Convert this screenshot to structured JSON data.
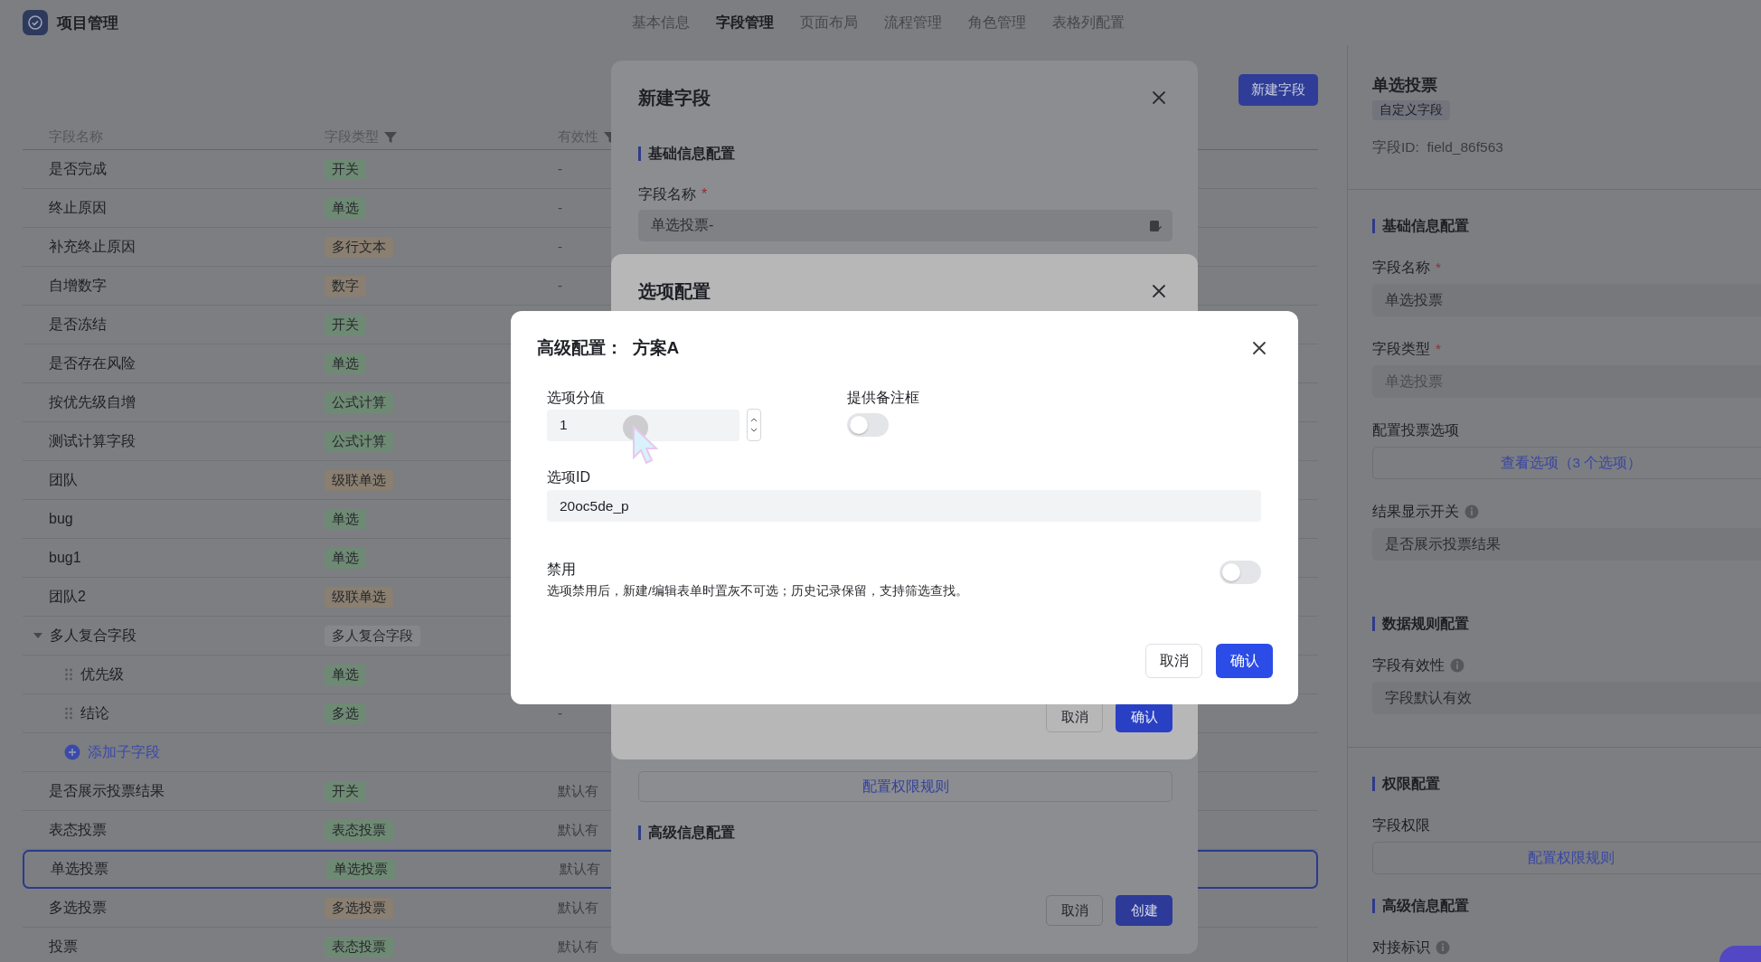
{
  "app": {
    "title": "项目管理"
  },
  "nav_tabs": [
    {
      "label": "基本信息",
      "selected": false
    },
    {
      "label": "字段管理",
      "selected": true
    },
    {
      "label": "页面布局",
      "selected": false
    },
    {
      "label": "流程管理",
      "selected": false
    },
    {
      "label": "角色管理",
      "selected": false
    },
    {
      "label": "表格列配置",
      "selected": false
    }
  ],
  "new_field_button": "新建字段",
  "table": {
    "columns": [
      {
        "label": "字段名称",
        "filter": false
      },
      {
        "label": "字段类型",
        "filter": true
      },
      {
        "label": "有效性",
        "filter": true
      }
    ],
    "rows": [
      {
        "name": "是否完成",
        "type": "开关",
        "color": "#6f8a74",
        "validity": "-",
        "selected": false
      },
      {
        "name": "终止原因",
        "type": "单选",
        "color": "#6f8a74",
        "validity": "-",
        "selected": false
      },
      {
        "name": "补充终止原因",
        "type": "多行文本",
        "color": "#8a7f70",
        "validity": "-",
        "selected": false
      },
      {
        "name": "自增数字",
        "type": "数字",
        "color": "#8a7f70",
        "validity": "-",
        "selected": false
      },
      {
        "name": "是否冻结",
        "type": "开关",
        "color": "#6f8a74",
        "selected": false
      },
      {
        "name": "是否存在风险",
        "type": "单选",
        "color": "#6f8a74",
        "selected": false
      },
      {
        "name": "按优先级自增",
        "type": "公式计算",
        "color": "#6f8a74",
        "selected": false
      },
      {
        "name": "测试计算字段",
        "type": "公式计算",
        "color": "#6f8a74",
        "selected": false
      },
      {
        "name": "团队",
        "type": "级联单选",
        "color": "#8a7f70",
        "selected": false
      },
      {
        "name": "bug",
        "type": "单选",
        "color": "#6f8a74",
        "selected": false
      },
      {
        "name": "bug1",
        "type": "单选",
        "color": "#6f8a74",
        "selected": false
      },
      {
        "name": "团队2",
        "type": "级联单选",
        "color": "#8a7f70",
        "selected": false
      },
      {
        "name": "多人复合字段",
        "type": "多人复合字段",
        "color": "#85878b",
        "selected": false,
        "expanded": true,
        "add_child": "添加子字段",
        "children": [
          {
            "name": "优先级",
            "type": "单选",
            "color": "#6f8a74",
            "selected": false
          },
          {
            "name": "结论",
            "type": "多选",
            "color": "#6f8a74",
            "validity": "-",
            "selected": false
          }
        ]
      },
      {
        "name": "是否展示投票结果",
        "type": "开关",
        "color": "#6f8a74",
        "validity": "默认有",
        "selected": false
      },
      {
        "name": "表态投票",
        "type": "表态投票",
        "color": "#6f8a74",
        "validity": "默认有",
        "selected": false
      },
      {
        "name": "单选投票",
        "type": "单选投票",
        "color": "#6f8a74",
        "validity": "默认有",
        "selected": true
      },
      {
        "name": "多选投票",
        "type": "多选投票",
        "color": "#8a7f70",
        "validity": "默认有",
        "selected": false
      },
      {
        "name": "投票",
        "type": "表态投票",
        "color": "#6f8a74",
        "validity": "默认有",
        "selected": false
      }
    ]
  },
  "detail_panel": {
    "title": "单选投票",
    "tag": "自定义字段",
    "field_id": "字段ID:  field_86f563",
    "sections": [
      {
        "heading": "基础信息配置",
        "fields": [
          {
            "kind": "input",
            "label": "字段名称",
            "required_mark": "*",
            "info": false,
            "value": "单选投票",
            "disabled": false
          },
          {
            "kind": "input",
            "label": "字段类型",
            "required_mark": "*",
            "info": false,
            "value": "单选投票",
            "disabled": true
          },
          {
            "kind": "link",
            "label": "配置投票选项",
            "info": false,
            "link": "查看选项（3 个选项）"
          },
          {
            "kind": "input",
            "label": "结果显示开关",
            "info": true,
            "value": "是否展示投票结果",
            "disabled": false
          }
        ]
      },
      {
        "heading": "数据规则配置",
        "fields": [
          {
            "kind": "input",
            "label": "字段有效性",
            "info": true,
            "value": "字段默认有效",
            "disabled": false
          }
        ]
      },
      {
        "heading": "权限配置",
        "fields": [
          {
            "kind": "link",
            "label": "字段权限",
            "info": false,
            "link": "配置权限规则"
          }
        ]
      },
      {
        "heading": "高级信息配置",
        "fields": [
          {
            "kind": "label",
            "label": "对接标识",
            "info": true
          }
        ]
      }
    ]
  },
  "new_field_dialog": {
    "title": "新建字段",
    "section": "基础信息配置",
    "name_label": "字段名称",
    "required_mark": "*",
    "name_value": "单选投票-",
    "permission_link": "配置权限规则",
    "advanced_section": "高级信息配置",
    "buttons": [
      {
        "label": "取消",
        "kind": "secondary"
      },
      {
        "label": "创建",
        "kind": "primary"
      }
    ]
  },
  "option_dialog": {
    "title": "选项配置",
    "buttons": [
      {
        "label": "取消",
        "kind": "secondary"
      },
      {
        "label": "确认",
        "kind": "primary"
      }
    ]
  },
  "advanced_dialog": {
    "title": "高级配置：  方案A",
    "score_label": "选项分值",
    "score_value": "1",
    "note_label": "提供备注框",
    "note_toggle": {
      "on": false
    },
    "id_label": "选项ID",
    "id_value": "20oc5de_p",
    "disable_label": "禁用",
    "disable_desc": "选项禁用后，新建/编辑表单时置灰不可选；历史记录保留，支持筛选查找。",
    "disable_toggle": {
      "on": false
    },
    "buttons": [
      {
        "label": "取消",
        "kind": "secondary"
      },
      {
        "label": "确认",
        "kind": "primary"
      }
    ]
  }
}
